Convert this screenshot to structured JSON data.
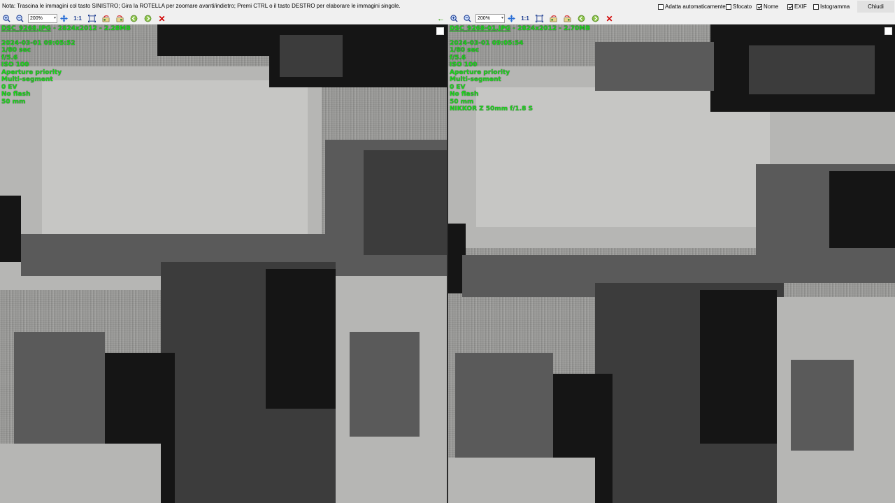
{
  "note": "Nota: Trascina le immagini col tasto SINISTRO; Gira la ROTELLA per zoomare avanti/indietro; Premi CTRL o il tasto DESTRO per elaborare le immagini singole.",
  "options": [
    {
      "label": "Adatta automaticamente",
      "checked": false
    },
    {
      "label": "Sfocato",
      "checked": false
    },
    {
      "label": "Nome",
      "checked": true
    },
    {
      "label": "EXIF",
      "checked": true
    },
    {
      "label": "Istogramma",
      "checked": false
    }
  ],
  "close_label": "Chiudi",
  "toolbar": {
    "zoom_value": "200%",
    "one_to_one": "1:1",
    "icons": [
      "zoom-in-icon",
      "zoom-out-icon",
      "move-icon",
      "fit-icon",
      "rotate-left-icon",
      "rotate-right-icon",
      "prev-icon",
      "next-icon",
      "close-icon"
    ]
  },
  "left_image": {
    "filename": "DSC_9268.JPG",
    "dims": "2824x2012",
    "size": "2.28MB",
    "exif": [
      "2024-03-01 09:05:52",
      "1/80 sec",
      "f/5.6",
      "ISO 100",
      "Aperture priority",
      "Multi-segment",
      "0 EV",
      "No flash",
      "50 mm"
    ]
  },
  "right_image": {
    "filename": "DSC_9268-01.JPG",
    "dims": "2824x2012",
    "size": "2.70MB",
    "exif": [
      "2024-03-01 09:05:54",
      "1/80 sec",
      "f/5.6",
      "ISO 100",
      "Aperture priority",
      "Multi-segment",
      "0 EV",
      "No flash",
      "50 mm",
      "NIKKOR Z 50mm f/1.8 S"
    ]
  },
  "colors": {
    "exif_text": "#1bd91b",
    "background": "#f0f0f0",
    "close_red": "#d00000",
    "arrow_green": "#2aa000"
  }
}
